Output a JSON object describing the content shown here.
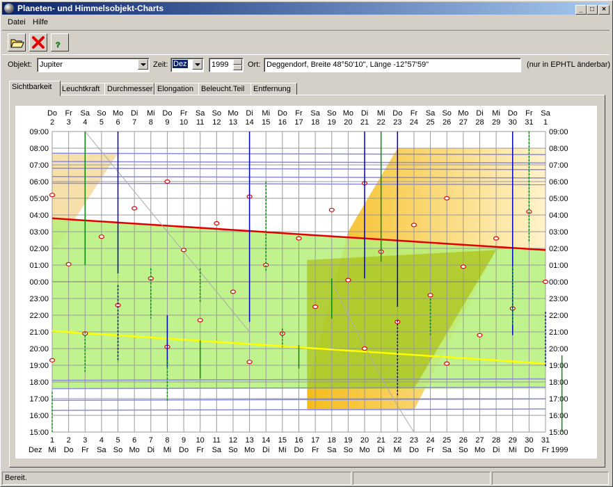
{
  "window": {
    "title": "Planeten- und Himmelsobjekt-Charts"
  },
  "menu": {
    "items": [
      "Datei",
      "Hilfe"
    ]
  },
  "controls": {
    "objekt_label": "Objekt:",
    "objekt_value": "Jupiter",
    "zeit_label": "Zeit:",
    "month_value": "Dez",
    "year_value": "1999",
    "ort_label": "Ort:",
    "ort_value": "Deggendorf, Breite 48°50'10\", Länge -12°57'59\"",
    "ort_note": "(nur in EPHTL änderbar)"
  },
  "tabs": [
    "Sichtbarkeit",
    "Leuchtkraft",
    "Durchmesser",
    "Elongation",
    "Beleucht.Teil",
    "Entfernung"
  ],
  "status": {
    "text": "Bereit."
  },
  "chart_data": {
    "type": "visibility-chart",
    "top_axis": {
      "days": [
        "Do",
        "Fr",
        "Sa",
        "So",
        "Mo",
        "Di",
        "Mi",
        "Do",
        "Fr",
        "Sa",
        "So",
        "Mo",
        "Di",
        "Mi",
        "Do",
        "Fr",
        "Sa",
        "So",
        "Mo",
        "Di",
        "Mi",
        "Do",
        "Fr",
        "Sa",
        "So",
        "Mo",
        "Di",
        "Mi",
        "Do",
        "Fr",
        "Sa"
      ],
      "dates": [
        "2",
        "3",
        "4",
        "5",
        "6",
        "7",
        "8",
        "9",
        "10",
        "11",
        "12",
        "13",
        "14",
        "15",
        "16",
        "17",
        "18",
        "19",
        "20",
        "21",
        "22",
        "23",
        "24",
        "25",
        "26",
        "27",
        "28",
        "29",
        "30",
        "31",
        "1"
      ]
    },
    "bottom_axis": {
      "dates": [
        "1",
        "2",
        "3",
        "4",
        "5",
        "6",
        "7",
        "8",
        "9",
        "10",
        "11",
        "12",
        "13",
        "14",
        "15",
        "16",
        "17",
        "18",
        "19",
        "20",
        "21",
        "22",
        "23",
        "24",
        "25",
        "26",
        "27",
        "28",
        "29",
        "30",
        "31"
      ],
      "days": [
        "Mi",
        "Do",
        "Fr",
        "Sa",
        "So",
        "Mo",
        "Di",
        "Mi",
        "Do",
        "Fr",
        "Sa",
        "So",
        "Mo",
        "Di",
        "Mi",
        "Do",
        "Fr",
        "Sa",
        "So",
        "Mo",
        "Di",
        "Mi",
        "Do",
        "Fr",
        "Sa",
        "So",
        "Mo",
        "Di",
        "Mi",
        "Do",
        "Fr"
      ],
      "month": "Dez",
      "year": "1999"
    },
    "y_ticks": [
      "09:00",
      "08:00",
      "07:00",
      "06:00",
      "05:00",
      "04:00",
      "03:00",
      "02:00",
      "01:00",
      "00:00",
      "23:00",
      "22:00",
      "21:00",
      "20:00",
      "19:00",
      "18:00",
      "17:00",
      "16:00",
      "15:00"
    ],
    "y_range_hours": [
      15,
      33
    ],
    "object_line": {
      "color": "#e00000",
      "start": 3.8,
      "end": 1.9
    },
    "transit_line": {
      "color": "#ffff00",
      "start": 21.05,
      "end": 19.1
    },
    "moon_positions": [
      {
        "day": 1,
        "t": 5.2
      },
      {
        "day": 1,
        "t": 19.3
      },
      {
        "day": 2,
        "t": 1.05
      },
      {
        "day": 3,
        "t": 20.9
      },
      {
        "day": 4,
        "t": 2.7
      },
      {
        "day": 5,
        "t": 22.6
      },
      {
        "day": 6,
        "t": 4.4
      },
      {
        "day": 7,
        "t": 0.2
      },
      {
        "day": 8,
        "t": 6.0
      },
      {
        "day": 8,
        "t": 20.1
      },
      {
        "day": 9,
        "t": 1.9
      },
      {
        "day": 10,
        "t": 21.7
      },
      {
        "day": 11,
        "t": 3.5
      },
      {
        "day": 12,
        "t": 23.4
      },
      {
        "day": 13,
        "t": 5.1
      },
      {
        "day": 13,
        "t": 19.2
      },
      {
        "day": 14,
        "t": 1.0
      },
      {
        "day": 15,
        "t": 20.9
      },
      {
        "day": 16,
        "t": 2.6
      },
      {
        "day": 17,
        "t": 22.5
      },
      {
        "day": 18,
        "t": 4.3
      },
      {
        "day": 19,
        "t": 0.1
      },
      {
        "day": 20,
        "t": 5.9
      },
      {
        "day": 20,
        "t": 20.0
      },
      {
        "day": 21,
        "t": 1.8
      },
      {
        "day": 22,
        "t": 21.6
      },
      {
        "day": 23,
        "t": 3.4
      },
      {
        "day": 24,
        "t": 23.2
      },
      {
        "day": 25,
        "t": 5.0
      },
      {
        "day": 25,
        "t": 19.1
      },
      {
        "day": 26,
        "t": 0.9
      },
      {
        "day": 27,
        "t": 20.8
      },
      {
        "day": 28,
        "t": 2.6
      },
      {
        "day": 29,
        "t": 22.4
      },
      {
        "day": 30,
        "t": 4.2
      },
      {
        "day": 31,
        "t": 0.0
      }
    ]
  }
}
